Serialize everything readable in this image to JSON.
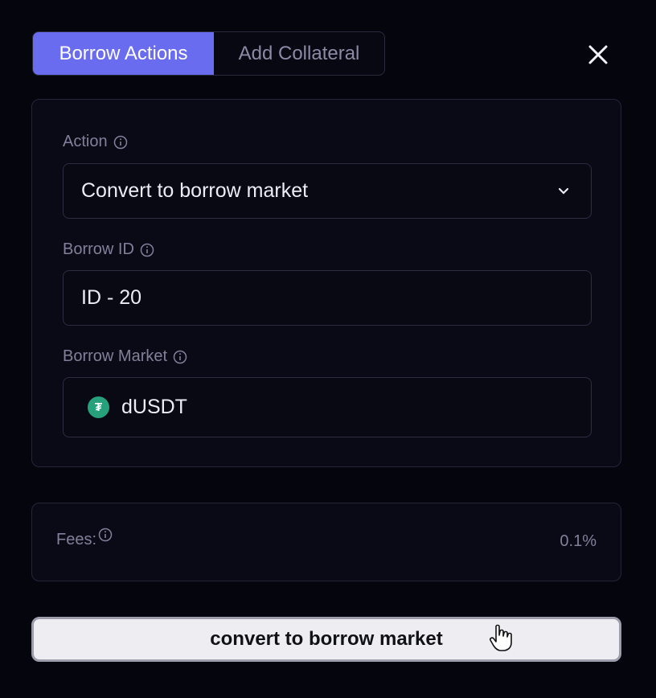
{
  "tabs": [
    {
      "label": "Borrow Actions"
    },
    {
      "label": "Add Collateral"
    }
  ],
  "form": {
    "action": {
      "label": "Action",
      "value": "Convert to borrow market"
    },
    "borrow_id": {
      "label": "Borrow ID",
      "value": "ID - 20"
    },
    "borrow_market": {
      "label": "Borrow Market",
      "value": "dUSDT",
      "token_symbol": "₮",
      "icon": "tether-token-icon",
      "icon_color": "#26a17b"
    }
  },
  "fees": {
    "label": "Fees:",
    "value": "0.1%"
  },
  "submit": {
    "label": "convert to borrow market"
  },
  "colors": {
    "accent": "#6a6cf0",
    "background": "#05050d"
  }
}
